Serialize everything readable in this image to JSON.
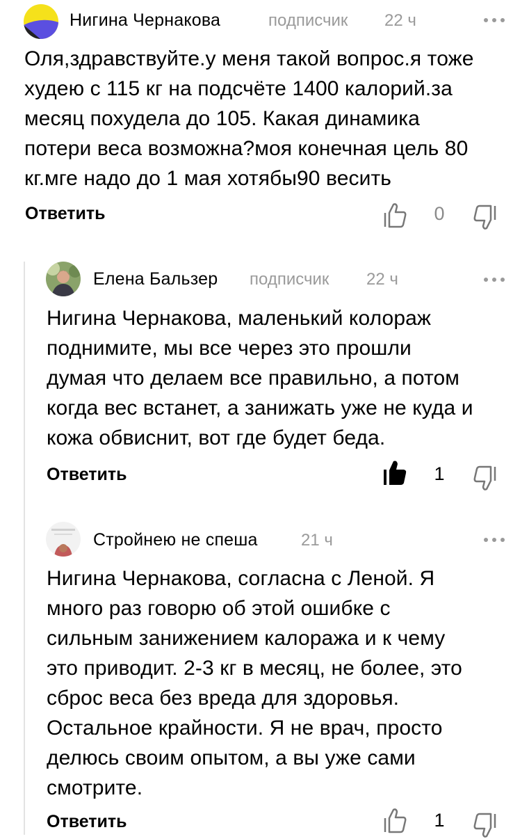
{
  "comments": [
    {
      "author": "Нигина Чернакова",
      "role": "подписчик",
      "time": "22 ч",
      "lines": [
        "Оля,здравствуйте.у меня такой вопрос.я тоже",
        "худею с 115 кг на подсчёте 1400 калорий.за",
        "месяц похудела до 105. Какая динамика",
        "потери веса возможна?моя конечная цель 80",
        "кг.мге надо до 1 мая хотябы90 весить"
      ],
      "reply_label": "Ответить",
      "likes": "0",
      "liked": false
    },
    {
      "author": "Елена Бальзер",
      "role": "подписчик",
      "time": "22 ч",
      "lines": [
        "Нигина Чернакова, маленький колораж",
        "поднимите, мы все через это прошли",
        "думая что делаем все правильно, а потом",
        "когда вес встанет, а занижать уже не куда и",
        "кожа обвиснит, вот где будет беда."
      ],
      "reply_label": "Ответить",
      "likes": "1",
      "liked": true
    },
    {
      "author": "Стройнею не спеша",
      "role": "",
      "time": "21 ч",
      "lines": [
        "Нигина Чернакова, согласна с Леной. Я",
        "много раз говорю об этой ошибке с",
        "сильным занижением калоража и к чему",
        "это приводит. 2-3 кг в месяц, не более, это",
        "сброс веса без вреда для здоровья.",
        "Остальное крайности. Я не врач, просто",
        "делюсь своим опытом, а вы уже сами",
        "смотрите."
      ],
      "reply_label": "Ответить",
      "likes": "1",
      "liked": false
    }
  ],
  "colors": {
    "meta_gray": "#9a9a9a",
    "avatar1_yellow": "#f5e11b",
    "avatar1_purple": "#5b4fe0"
  }
}
